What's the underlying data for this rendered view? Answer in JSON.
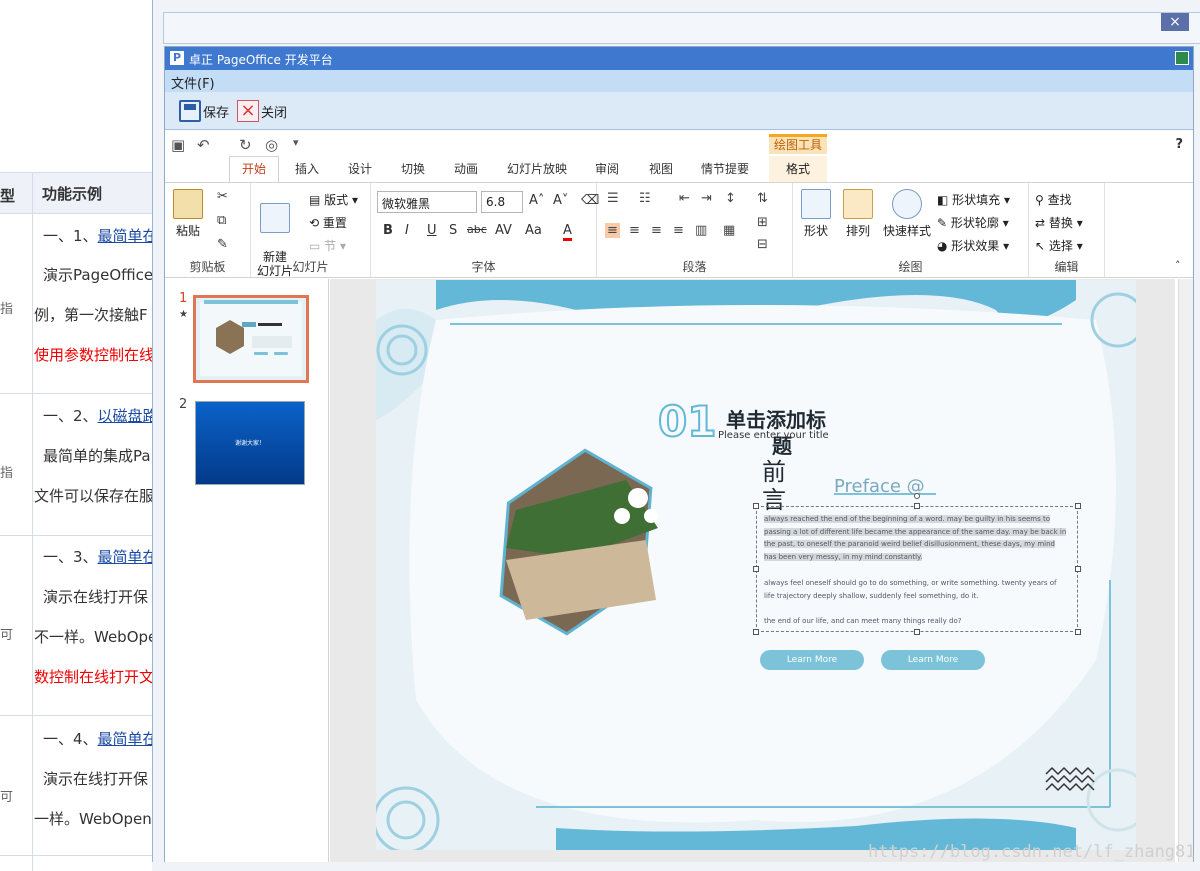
{
  "background_page": {
    "columns": [
      "型",
      "功能示例"
    ],
    "rows": [
      {
        "mark": "指",
        "lines": [
          {
            "prefix": "一、1、",
            "link": "最简单在"
          },
          {
            "text": "演示PageOffice"
          },
          {
            "text": "例，第一次接触F"
          },
          {
            "text": "使用参数控制在线",
            "red": true
          }
        ]
      },
      {
        "mark": "指",
        "lines": [
          {
            "prefix": "一、2、",
            "link": "以磁盘路"
          },
          {
            "text": "最简单的集成Pa"
          },
          {
            "text": "文件可以保存在服"
          }
        ]
      },
      {
        "mark": "可",
        "lines": [
          {
            "prefix": "一、3、",
            "link": "最简单在"
          },
          {
            "text": "演示在线打开保"
          },
          {
            "text": "不一样。WebOpe"
          },
          {
            "text": "数控制在线打开文",
            "red": true
          }
        ]
      },
      {
        "mark": "可",
        "lines": [
          {
            "prefix": "一、4、",
            "link": "最简单在"
          },
          {
            "text": "演示在线打开保"
          },
          {
            "text": "一样。WebOpen"
          }
        ]
      }
    ]
  },
  "dialog": {
    "close_label": "×"
  },
  "pageoffice": {
    "logo": "P",
    "title": "卓正 PageOffice 开发平台",
    "menu_file": "文件(F)",
    "toolbar": {
      "save": "保存",
      "close": "关闭"
    }
  },
  "ribbon": {
    "context_group": "绘图工具",
    "help": "?",
    "tabs": [
      "开始",
      "插入",
      "设计",
      "切换",
      "动画",
      "幻灯片放映",
      "审阅",
      "视图",
      "情节提要"
    ],
    "format_tab": "格式",
    "groups": {
      "clipboard": {
        "label": "剪贴板",
        "paste": "粘贴"
      },
      "slides": {
        "label": "幻灯片",
        "new_slide": "新建\n幻灯片",
        "layout": "版式",
        "reset": "重置",
        "section": "节"
      },
      "font": {
        "label": "字体",
        "font_name": "微软雅黑",
        "font_size": "6.8"
      },
      "paragraph": {
        "label": "段落"
      },
      "drawing": {
        "label": "绘图",
        "shapes": "形状",
        "arrange": "排列",
        "quick_styles": "快速样式",
        "fill": "形状填充",
        "outline": "形状轮廓",
        "effects": "形状效果"
      },
      "editing": {
        "label": "编辑",
        "find": "查找",
        "replace": "替换",
        "select": "选择"
      }
    }
  },
  "thumbnails": [
    {
      "number": "1",
      "star": "★",
      "selected": true
    },
    {
      "number": "2",
      "text": "谢谢大家！",
      "selected": false
    }
  ],
  "slide": {
    "logo_text": "01",
    "title_line1": "单击添加标",
    "title_line2": "题",
    "subtitle": "Please enter your title",
    "preface_cn": "前言",
    "preface_en": "Preface @",
    "body": [
      "always reached the end of the beginning of a word. may be guilty in his seems to passing a lot of different life became the appearance of the same day. may be back in the past, to oneself the paranoid weird belief disillusionment, these days, my mind has been very messy, in my mind constantly.",
      "always feel oneself should go to do something, or write something. twenty years of life trajectory deeply shallow, suddenly feel something, do it.",
      "the end of our life, and can meet many things really do?"
    ],
    "button1": "Learn More",
    "button2": "Learn More"
  },
  "watermark": "https://blog.csdn.net/lf_zhang81",
  "colors": {
    "titlebar": "#3f78cf",
    "active_tab": "#c43e1c",
    "slide_accent": "#7cc3da"
  }
}
